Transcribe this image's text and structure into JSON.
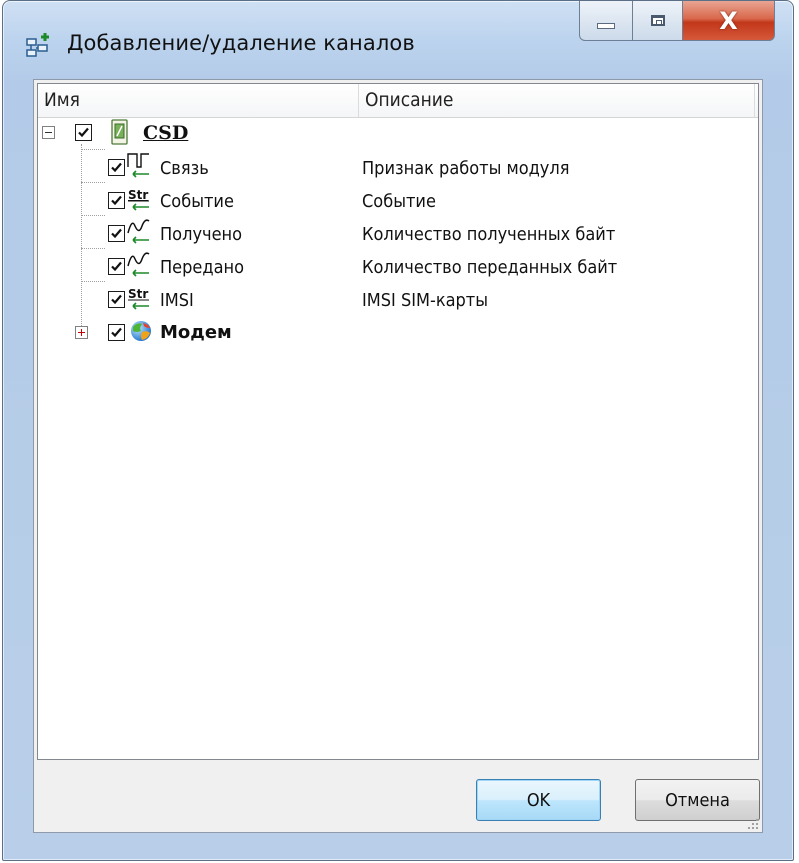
{
  "window": {
    "title": "Добавление/удаление каналов",
    "close_glyph": "X"
  },
  "columns": [
    {
      "label": "Имя"
    },
    {
      "label": "Описание"
    }
  ],
  "tree": {
    "root": {
      "name": "CSD",
      "expanded": true,
      "checked": true,
      "icon": "module-icon",
      "children": [
        {
          "name": "Связь",
          "description": "Признак работы модуля",
          "icon": "square-wave-icon",
          "checked": true
        },
        {
          "name": "Событие",
          "description": "Событие",
          "icon": "string-channel-icon",
          "checked": true
        },
        {
          "name": "Получено",
          "description": "Количество полученных байт",
          "icon": "analog-wave-icon",
          "checked": true
        },
        {
          "name": "Передано",
          "description": "Количество переданных байт",
          "icon": "analog-wave-icon",
          "checked": true
        },
        {
          "name": "IMSI",
          "description": "IMSI SIM-карты",
          "icon": "string-channel-icon",
          "checked": true
        }
      ]
    },
    "modem": {
      "name": "Модем",
      "expanded": false,
      "checked": true,
      "icon": "modem-globe-icon"
    }
  },
  "buttons": {
    "ok_label": "OK",
    "cancel_label": "Отмена"
  },
  "colors": {
    "accent_green": "#1d8a2a",
    "default_button_border": "#3c7fb1",
    "close_button": "#c2371a"
  }
}
